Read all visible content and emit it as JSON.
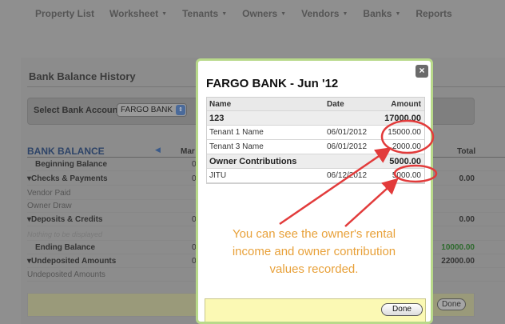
{
  "nav": {
    "items": [
      {
        "label": "Property List",
        "dropdown": false
      },
      {
        "label": "Worksheet",
        "dropdown": true
      },
      {
        "label": "Tenants",
        "dropdown": true
      },
      {
        "label": "Owners",
        "dropdown": true
      },
      {
        "label": "Vendors",
        "dropdown": true
      },
      {
        "label": "Banks",
        "dropdown": true
      },
      {
        "label": "Reports",
        "dropdown": false
      }
    ]
  },
  "page": {
    "title": "Bank Balance History",
    "select_label": "Select Bank Account:",
    "select_value": "FARGO BANK",
    "bank_balance_heading": "BANK BALANCE",
    "col_month": "Mar",
    "col_total": "Total",
    "rows": [
      {
        "label": "Beginning Balance",
        "style": "b ind",
        "mid": "0",
        "total": ""
      },
      {
        "label": "▾Checks & Payments",
        "style": "b",
        "mid": "0",
        "total": "0.00"
      },
      {
        "label": "Vendor Paid",
        "style": "sub",
        "mid": "",
        "total": ""
      },
      {
        "label": "Owner Draw",
        "style": "sub",
        "mid": "",
        "total": ""
      },
      {
        "label": "▾Deposits & Credits",
        "style": "b",
        "mid": "0",
        "total": "0.00"
      },
      {
        "label": "Nothing to be displayed",
        "style": "faint",
        "mid": "",
        "total": ""
      },
      {
        "label": "Ending Balance",
        "style": "b ind",
        "mid": "0",
        "total": "10000.00"
      },
      {
        "label": "▾Undeposited Amounts",
        "style": "b",
        "mid": "0",
        "total": "22000.00"
      },
      {
        "label": "Undeposited Amounts",
        "style": "sub",
        "mid": "",
        "total": ""
      }
    ],
    "done_label": "Done"
  },
  "modal": {
    "title": "FARGO BANK - Jun '12",
    "close_glyph": "×",
    "columns": {
      "name": "Name",
      "date": "Date",
      "amount": "Amount"
    },
    "groups": [
      {
        "name": "123",
        "total": "17000.00",
        "rows": [
          {
            "name": "Tenant 1 Name",
            "date": "06/01/2012",
            "amount": "15000.00"
          },
          {
            "name": "Tenant 3 Name",
            "date": "06/01/2012",
            "amount": "2000.00"
          }
        ]
      },
      {
        "name": "Owner Contributions",
        "total": "5000.00",
        "rows": [
          {
            "name": "JITU",
            "date": "06/12/2012",
            "amount": "5000.00"
          }
        ]
      }
    ],
    "done_label": "Done"
  },
  "annotation": {
    "lines": [
      "You can see the owner's rental",
      "income and owner contribution",
      "values recorded."
    ],
    "color": "#e8a13a",
    "marker_color": "#e23b3b"
  }
}
